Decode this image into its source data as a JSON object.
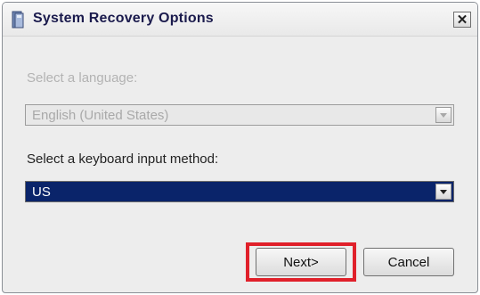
{
  "window": {
    "title": "System Recovery Options",
    "close_glyph": "✕"
  },
  "language": {
    "label": "Select a language:",
    "selected": "English (United States)",
    "enabled": false
  },
  "keyboard": {
    "label": "Select a keyboard input method:",
    "selected": "US",
    "enabled": true
  },
  "buttons": {
    "next": "Next>",
    "cancel": "Cancel"
  },
  "colors": {
    "selection": "#0a246a",
    "highlight": "#e0202a"
  },
  "icons": {
    "title": "recovery-app-icon",
    "close": "close-icon",
    "dropdown": "chevron-down-icon"
  }
}
